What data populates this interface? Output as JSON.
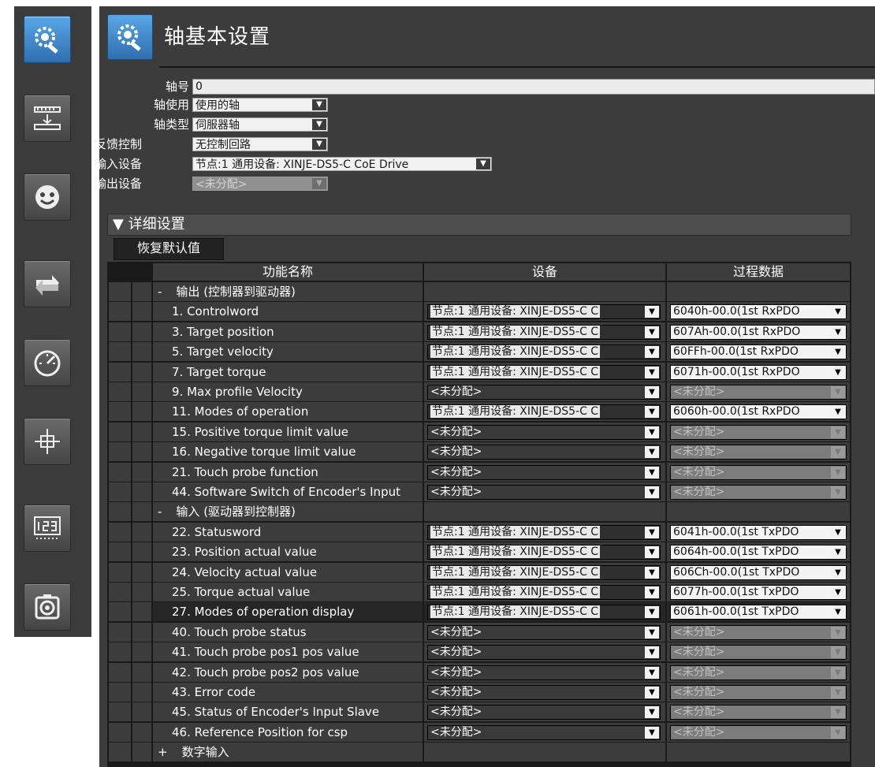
{
  "title": "轴基本设置",
  "fields": {
    "axis_no_label": "轴号",
    "axis_no_value": "0",
    "axis_use_label": "轴使用",
    "axis_use_value": "使用的轴",
    "axis_type_label": "轴类型",
    "axis_type_value": "伺服器轴",
    "feedback_label": "反馈控制",
    "feedback_value": "无控制回路",
    "input_label": "输入设备",
    "input_value": "节点:1  通用设备: XINJE-DS5-C CoE Drive",
    "output_label": "输出设备",
    "output_value": "<未分配>"
  },
  "detail": {
    "label": "▼ 详细设置",
    "restore": "恢复默认值"
  },
  "table": {
    "headers": [
      "功能名称",
      "设备",
      "过程数据"
    ],
    "rows": [
      {
        "kind": "group",
        "sign": "-",
        "name": "输出 (控制器到驱动器)"
      },
      {
        "kind": "item",
        "name": "1. Controlword",
        "device": "节点:1  通用设备: XINJE-DS5-C C",
        "pdo": "6040h-00.0(1st RxPDO"
      },
      {
        "kind": "item",
        "name": "3. Target position",
        "device": "节点:1  通用设备: XINJE-DS5-C C",
        "pdo": "607Ah-00.0(1st RxPDO"
      },
      {
        "kind": "item",
        "name": "5. Target velocity",
        "device": "节点:1  通用设备: XINJE-DS5-C C",
        "pdo": "60FFh-00.0(1st RxPDO"
      },
      {
        "kind": "item",
        "name": "7. Target torque",
        "device": "节点:1  通用设备: XINJE-DS5-C C",
        "pdo": "6071h-00.0(1st RxPDO"
      },
      {
        "kind": "item",
        "name": "9. Max profile Velocity",
        "device": "<未分配>",
        "pdo": "<未分配>"
      },
      {
        "kind": "item",
        "name": "11. Modes of operation",
        "device": "节点:1  通用设备: XINJE-DS5-C C",
        "pdo": "6060h-00.0(1st RxPDO"
      },
      {
        "kind": "item",
        "name": "15. Positive torque limit value",
        "device": "<未分配>",
        "pdo": "<未分配>"
      },
      {
        "kind": "item",
        "name": "16. Negative torque limit value",
        "device": "<未分配>",
        "pdo": "<未分配>"
      },
      {
        "kind": "item",
        "name": "21. Touch probe function",
        "device": "<未分配>",
        "pdo": "<未分配>"
      },
      {
        "kind": "item",
        "name": "44. Software Switch of Encoder's Input",
        "device": "<未分配>",
        "pdo": "<未分配>"
      },
      {
        "kind": "group",
        "sign": "-",
        "name": "输入 (驱动器到控制器)"
      },
      {
        "kind": "item",
        "name": "22. Statusword",
        "device": "节点:1  通用设备: XINJE-DS5-C C",
        "pdo": "6041h-00.0(1st TxPDO"
      },
      {
        "kind": "item",
        "name": "23. Position actual value",
        "device": "节点:1  通用设备: XINJE-DS5-C C",
        "pdo": "6064h-00.0(1st TxPDO"
      },
      {
        "kind": "item",
        "name": "24. Velocity actual value",
        "device": "节点:1  通用设备: XINJE-DS5-C C",
        "pdo": "606Ch-00.0(1st TxPDO"
      },
      {
        "kind": "item",
        "name": "25. Torque actual value",
        "device": "节点:1  通用设备: XINJE-DS5-C C",
        "pdo": "6077h-00.0(1st TxPDO"
      },
      {
        "kind": "item",
        "name": "27. Modes of operation display",
        "device": "节点:1  通用设备: XINJE-DS5-C C",
        "pdo": "6061h-00.0(1st TxPDO",
        "selected": true
      },
      {
        "kind": "item",
        "name": "40. Touch probe status",
        "device": "<未分配>",
        "pdo": "<未分配>"
      },
      {
        "kind": "item",
        "name": "41. Touch probe pos1 pos value",
        "device": "<未分配>",
        "pdo": "<未分配>"
      },
      {
        "kind": "item",
        "name": "42. Touch probe pos2 pos value",
        "device": "<未分配>",
        "pdo": "<未分配>"
      },
      {
        "kind": "item",
        "name": "43. Error code",
        "device": "<未分配>",
        "pdo": "<未分配>"
      },
      {
        "kind": "item",
        "name": "45. Status of Encoder's Input Slave",
        "device": "<未分配>",
        "pdo": "<未分配>"
      },
      {
        "kind": "item",
        "name": "46. Reference Position for csp",
        "device": "<未分配>",
        "pdo": "<未分配>"
      },
      {
        "kind": "group",
        "sign": "+",
        "name": "数字输入"
      }
    ]
  },
  "rail_icons": [
    "axis-settings-icon",
    "ruler-icon",
    "face-icon",
    "arrows-icon",
    "gauge-icon",
    "crosshair-icon",
    "counter-icon",
    "camera-icon"
  ],
  "dropdown_arrow": "▼",
  "colors": {
    "panel": "#3c3c3c",
    "accent": "#3b82c9",
    "table_bg": "#1a1a1a"
  }
}
